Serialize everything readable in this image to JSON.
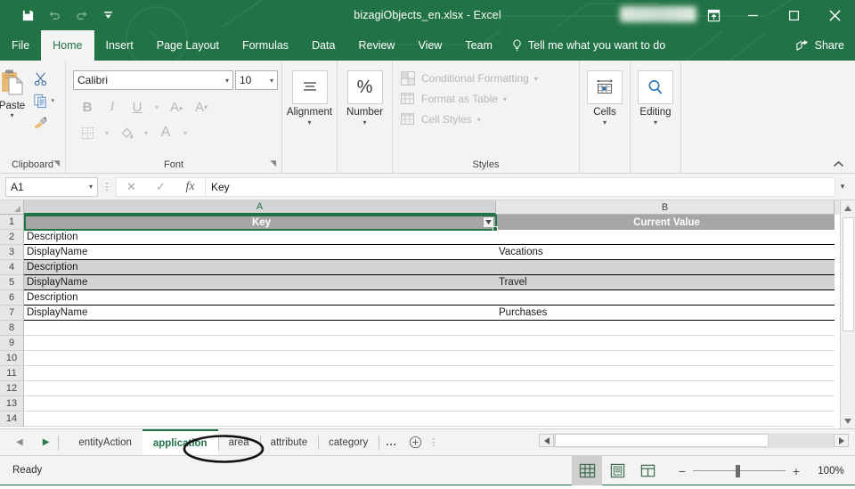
{
  "titlebar": {
    "quick_access": [
      {
        "name": "save-icon",
        "label": "Save"
      },
      {
        "name": "undo-icon",
        "label": "Undo"
      },
      {
        "name": "redo-icon",
        "label": "Redo"
      },
      {
        "name": "customize-qat-icon",
        "label": "Customize Quick Access Toolbar"
      }
    ],
    "document_title": "bizagiObjects_en.xlsx  -  Excel",
    "ribbon_display_options": "Ribbon Display Options",
    "minimize": "Minimize",
    "maximize": "Maximize",
    "close": "Close"
  },
  "ribbon_tabs": [
    {
      "label": "File",
      "active": false
    },
    {
      "label": "Home",
      "active": true
    },
    {
      "label": "Insert",
      "active": false
    },
    {
      "label": "Page Layout",
      "active": false
    },
    {
      "label": "Formulas",
      "active": false
    },
    {
      "label": "Data",
      "active": false
    },
    {
      "label": "Review",
      "active": false
    },
    {
      "label": "View",
      "active": false
    },
    {
      "label": "Team",
      "active": false
    }
  ],
  "tell_me": "Tell me what you want to do",
  "share": "Share",
  "ribbon": {
    "clipboard": {
      "label": "Clipboard",
      "paste": "Paste",
      "cut": "Cut",
      "copy": "Copy",
      "format_painter": "Format Painter"
    },
    "font": {
      "label": "Font",
      "font_name": "Calibri",
      "font_size": "10",
      "bold": "B",
      "italic": "I",
      "underline": "U",
      "increase_size": "A",
      "decrease_size": "A",
      "borders": "Borders",
      "fill_color": "Fill Color",
      "font_color": "A"
    },
    "alignment": {
      "label": "Alignment"
    },
    "number": {
      "label": "Number",
      "symbol": "%"
    },
    "styles": {
      "label": "Styles",
      "items": [
        "Conditional Formatting",
        "Format as Table",
        "Cell Styles"
      ]
    },
    "cells": {
      "label": "Cells"
    },
    "editing": {
      "label": "Editing"
    },
    "collapse": "Collapse the Ribbon"
  },
  "formula_bar": {
    "name_box": "A1",
    "cancel": "Cancel",
    "enter": "Enter",
    "insert_function": "fx",
    "value": "Key"
  },
  "grid": {
    "columns": [
      {
        "letter": "A",
        "selected": true
      },
      {
        "letter": "B",
        "selected": false
      }
    ],
    "row_numbers": [
      "1",
      "2",
      "3",
      "4",
      "5",
      "6",
      "7",
      "8",
      "9",
      "10",
      "11",
      "12",
      "13",
      "14"
    ],
    "rows": [
      {
        "num": "1",
        "a": "Key",
        "b": "Current Value",
        "style": "header"
      },
      {
        "num": "2",
        "a": "Description",
        "b": "",
        "style": "plain"
      },
      {
        "num": "3",
        "a": "DisplayName",
        "b": "Vacations",
        "style": "plain"
      },
      {
        "num": "4",
        "a": "Description",
        "b": "",
        "style": "band"
      },
      {
        "num": "5",
        "a": "DisplayName",
        "b": "Travel",
        "style": "band"
      },
      {
        "num": "6",
        "a": "Description",
        "b": "",
        "style": "plain"
      },
      {
        "num": "7",
        "a": "DisplayName",
        "b": "Purchases",
        "style": "plain"
      },
      {
        "num": "8",
        "a": "",
        "b": "",
        "style": "empty"
      },
      {
        "num": "9",
        "a": "",
        "b": "",
        "style": "empty"
      },
      {
        "num": "10",
        "a": "",
        "b": "",
        "style": "empty"
      },
      {
        "num": "11",
        "a": "",
        "b": "",
        "style": "empty"
      },
      {
        "num": "12",
        "a": "",
        "b": "",
        "style": "empty"
      },
      {
        "num": "13",
        "a": "",
        "b": "",
        "style": "empty"
      },
      {
        "num": "14",
        "a": "",
        "b": "",
        "style": "empty"
      }
    ],
    "active_cell": "A1",
    "filter_dropdown": "Filter"
  },
  "sheet_tabs": {
    "first": "First Sheet",
    "prev": "Previous Sheet",
    "tabs": [
      {
        "label": "entityAction",
        "active": false
      },
      {
        "label": "application",
        "active": true
      },
      {
        "label": "area",
        "active": false
      },
      {
        "label": "attribute",
        "active": false
      },
      {
        "label": "category",
        "active": false
      },
      {
        "label": "...",
        "active": false
      }
    ],
    "add_sheet": "New sheet",
    "more": "More"
  },
  "status": {
    "text": "Ready",
    "views": [
      {
        "name": "normal-view-icon",
        "label": "Normal",
        "active": true
      },
      {
        "name": "page-layout-view-icon",
        "label": "Page Layout",
        "active": false
      },
      {
        "name": "page-break-view-icon",
        "label": "Page Break Preview",
        "active": false
      }
    ],
    "zoom_out": "−",
    "zoom_in": "+",
    "zoom_level": "100%"
  },
  "colors": {
    "excel_green": "#217346",
    "header_gray": "#a6a6a6",
    "band_gray": "#d4d4d4",
    "ribbon_bg": "#f3f3f3"
  }
}
